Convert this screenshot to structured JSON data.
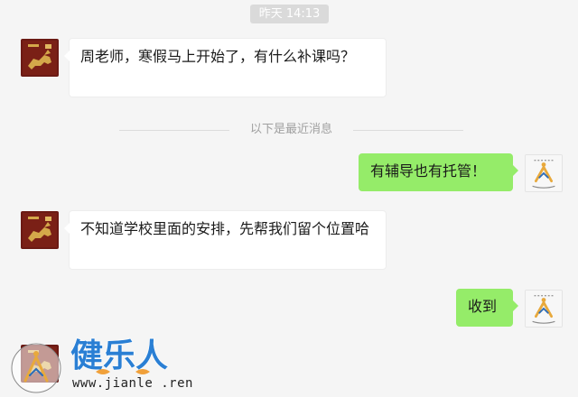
{
  "chat": {
    "timestamp": "昨天 14:13",
    "divider_label": "以下是最近消息",
    "messages": [
      {
        "side": "in",
        "text": "周老师，寒假马上开始了，有什么补课吗？"
      },
      {
        "side": "out",
        "text": "有辅导也有托管！"
      },
      {
        "side": "in",
        "text": "不知道学校里面的安排，先帮我们留个位置哈"
      },
      {
        "side": "out",
        "text": "收到"
      }
    ]
  },
  "avatars": {
    "contact": {
      "icon": "gold-horse-logo",
      "bg_color": "#6b1a14",
      "accent_color": "#d4a84a"
    },
    "teacher": {
      "icon": "education-logo",
      "accent_color": "#e8a93c"
    }
  },
  "watermark": {
    "brand": "健乐人",
    "url": "www.jianle .ren",
    "brand_color": "#2a7fd4"
  }
}
